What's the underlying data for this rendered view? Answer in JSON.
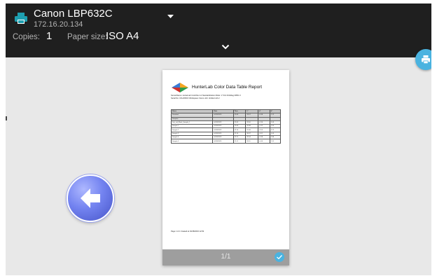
{
  "printer": {
    "name": "Canon LBP632C",
    "ip": "172.16.20.134"
  },
  "settings": {
    "copies_label": "Copies:",
    "copies_value": "1",
    "paper_label": "Paper size:",
    "paper_value": "ISO A4"
  },
  "preview": {
    "page_indicator": "1/1",
    "report": {
      "title": "HunterLab Color Data Table Report",
      "meta_line1": "SensorName: HunterLab ColorFlex L2     Standardization Mode: 1\" Port     D/10deg  D65/1 0",
      "meta_line2": "Serial No: CFL2009 R       Workspace: Demo      Job: Untitled Job 2",
      "columns": [
        "Name",
        "Date",
        "Time",
        "L*",
        "a*",
        "b*"
      ],
      "rows": [
        [
          "Standard",
          "04/18/2023",
          "12:08",
          "93.57",
          "-0.38",
          "2.12"
        ],
        [
          "Samples",
          "",
          "",
          "",
          "",
          ""
        ],
        [
          "Job_std_Blank_Sample_1",
          "04/18/2023",
          "12:09",
          "93.50",
          "-0.36",
          "2.09"
        ],
        [
          "Sample 1",
          "04/18/2023",
          "12:09",
          "92.88",
          "-0.42",
          "2.64"
        ],
        [
          "Sample 2",
          "04/18/2023",
          "12:10",
          "91.46",
          "-0.55",
          "3.12"
        ],
        [
          "Sample 3",
          "04/18/2023",
          "12:10",
          "90.87",
          "-0.61",
          "3.45"
        ],
        [
          "Sample 4",
          "04/18/2023",
          "12:11",
          "92.04",
          "-0.48",
          "2.88"
        ],
        [
          "Sample 5",
          "04/18/2023",
          "12:11",
          "93.11",
          "-0.40",
          "2.31"
        ]
      ],
      "page_info": "Page 1 of 1     Created at 04/18/2023 12:09"
    }
  },
  "icons": {
    "printer": "printer-icon",
    "dropdown": "dropdown-arrow-icon",
    "expand": "chevron-down-icon",
    "print_fab": "print-icon",
    "back": "arrow-left-icon",
    "page_selected": "check-icon"
  },
  "colors": {
    "accent": "#4ab3e0",
    "header_bg": "#1f1f1f",
    "preview_bg": "#e8e8e8",
    "footer_bar": "#9e9e9e",
    "printer_icon": "#1e9fb0"
  }
}
